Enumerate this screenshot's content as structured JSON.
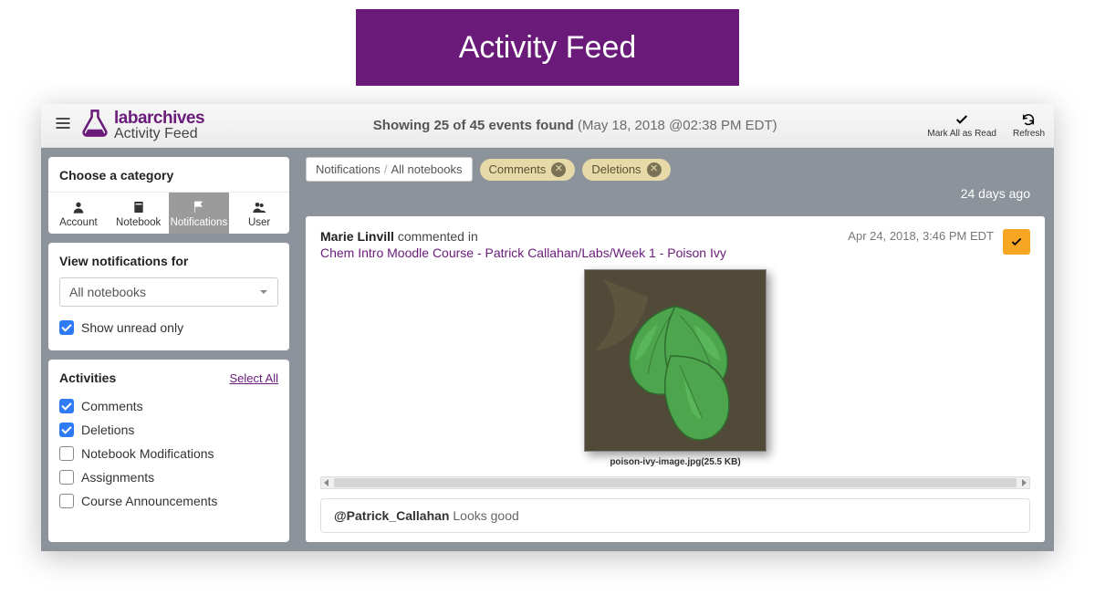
{
  "banner_title": "Activity Feed",
  "brand": {
    "name": "labarchives",
    "sub": "Activity Feed"
  },
  "status": {
    "prefix": "Showing ",
    "count": "25",
    "mid": " of ",
    "total": "45",
    "suffix": " events found ",
    "date": "(May 18, 2018 @02:38 PM EDT)"
  },
  "top_actions": {
    "mark_all": "Mark All as Read",
    "refresh": "Refresh"
  },
  "sidebar": {
    "category_title": "Choose a category",
    "tabs": {
      "account": "Account",
      "notebook": "Notebook",
      "notifications": "Notifications",
      "user": "User"
    },
    "notif_title": "View notifications for",
    "notebook_select": "All notebooks",
    "unread_only": "Show unread only",
    "activities_title": "Activities",
    "select_all": "Select All",
    "activities": {
      "comments": "Comments",
      "deletions": "Deletions",
      "notebook_mods": "Notebook Modifications",
      "assignments": "Assignments",
      "course_ann": "Course Announcements"
    }
  },
  "crumbs": {
    "notifications": "Notifications",
    "all_notebooks": "All notebooks"
  },
  "pills": {
    "comments": "Comments",
    "deletions": "Deletions"
  },
  "time_ago": "24 days ago",
  "card": {
    "user": "Marie Linvill",
    "action": "commented in",
    "link": "Chem Intro Moodle Course - Patrick Callahan/Labs/Week 1 - Poison Ivy",
    "date": "Apr 24, 2018, 3:46 PM EDT",
    "image_caption": "poison-ivy-image.jpg(25.5 KB)",
    "comment_mention": "@Patrick_Callahan",
    "comment_text": " Looks good"
  }
}
